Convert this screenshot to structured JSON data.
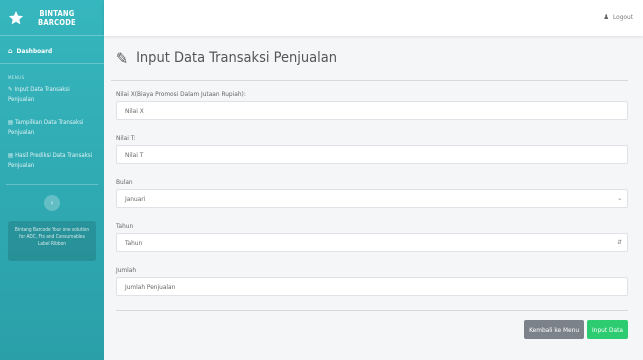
{
  "brand": {
    "line1": "BINTANG",
    "line2": "BARCODE"
  },
  "sidebar": {
    "dashboard": "Dashboard",
    "menu_heading": "MENUS",
    "items": [
      {
        "label": "Input Data Transaksi Penjualan"
      },
      {
        "label": "Tampilkan Data Transaksi Penjualan"
      },
      {
        "label": "Hasil Prediksi Data Transaksi Penjualan"
      }
    ],
    "promo": "Bintang Barcode Your one solution for ADC, Fts and Consumables Label Ribbon"
  },
  "topbar": {
    "logout": "Logout"
  },
  "page": {
    "title": "Input Data Transaksi Penjualan"
  },
  "form": {
    "x": {
      "label": "Nilai X(Biaya Promosi Dalam Jutaan Rupiah):",
      "placeholder": "Nilai X"
    },
    "t": {
      "label": "Nilai T:",
      "placeholder": "Nilai T"
    },
    "bulan": {
      "label": "Bulan",
      "value": "Januari"
    },
    "tahun": {
      "label": "Tahun",
      "placeholder": "Tahun"
    },
    "jumlah": {
      "label": "Jumlah",
      "placeholder": "Jumlah Penjualan"
    }
  },
  "actions": {
    "back": "Kembali ke Menu",
    "submit": "Input Data"
  },
  "colors": {
    "sidebar": "#36b6be",
    "submit": "#2ecc71",
    "back": "#7c828a"
  },
  "icons": {
    "brand": "star-icon",
    "dashboard": "home-icon",
    "nav_input": "pencil-icon",
    "nav_list": "list-icon",
    "logout": "user-icon",
    "header": "pencil-icon",
    "select": "chevron-down-icon",
    "number": "spinner-icon"
  }
}
